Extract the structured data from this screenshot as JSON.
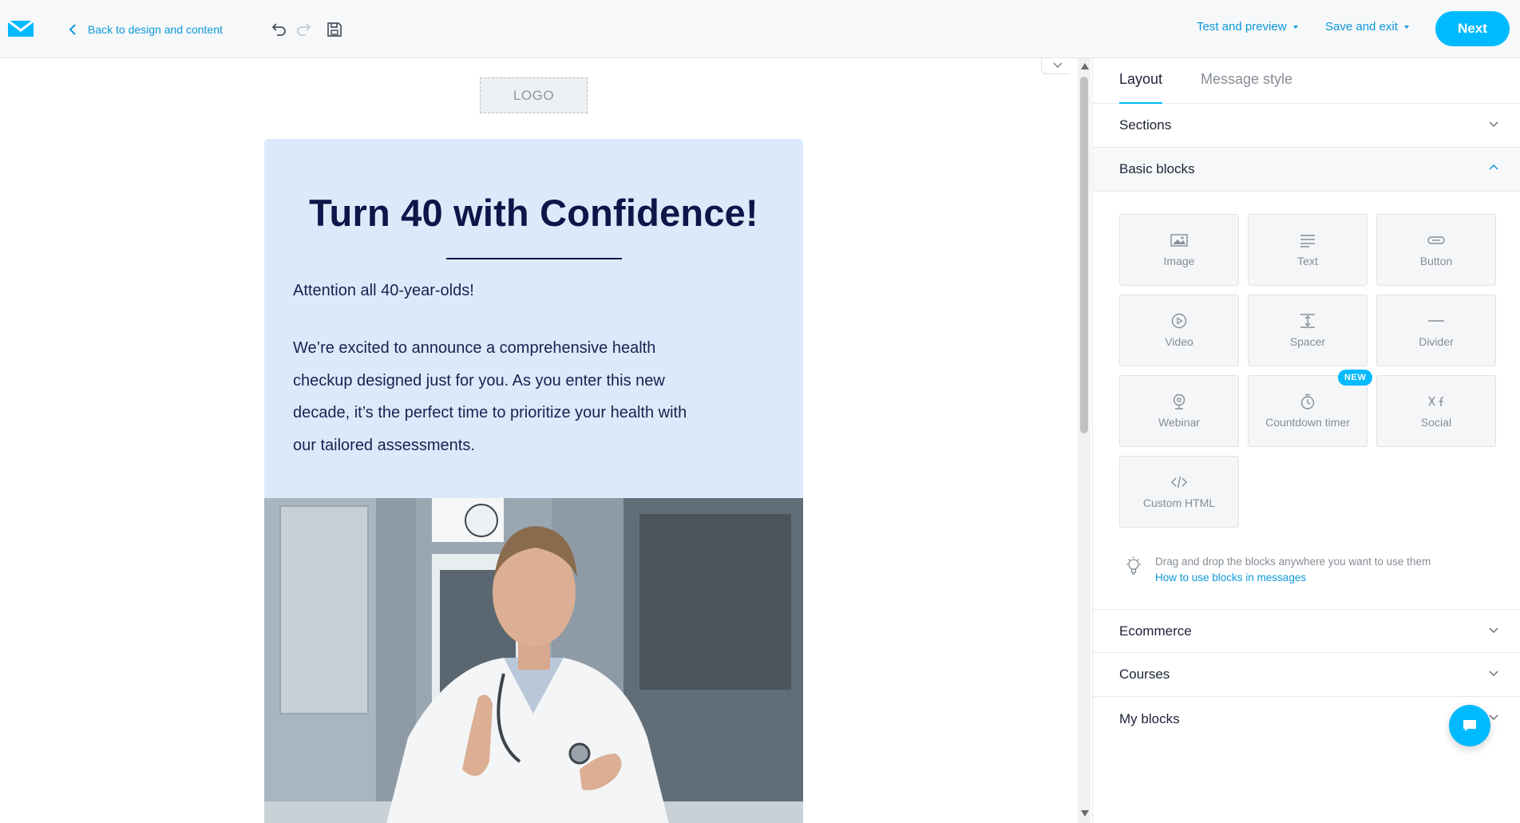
{
  "colors": {
    "accent": "#00baff",
    "link": "#0d99d9",
    "hero_background": "#dbeafa",
    "title_navy": "#0f1449"
  },
  "header": {
    "back_label": "Back to design and content",
    "test_preview_label": "Test and preview",
    "save_exit_label": "Save and exit",
    "next_label": "Next",
    "icons": [
      "brand-mail-logo",
      "back-chevron-icon",
      "undo-icon",
      "redo-icon",
      "save-icon"
    ]
  },
  "canvas": {
    "logo_placeholder": "LOGO",
    "email": {
      "title": "Turn 40 with Confidence!",
      "paragraph1": "Attention all 40-year-olds!",
      "paragraph2_lines": [
        "We’re excited to announce a comprehensive health",
        "checkup designed just for you. As you enter this new",
        "decade, it’s the perfect time to prioritize your health with",
        "our tailored assessments."
      ]
    }
  },
  "panel": {
    "tabs": [
      {
        "label": "Layout",
        "active": true
      },
      {
        "label": "Message style",
        "active": false
      }
    ],
    "sections_label": "Sections",
    "basic_blocks_label": "Basic blocks",
    "blocks": [
      {
        "label": "Image",
        "icon": "image-icon"
      },
      {
        "label": "Text",
        "icon": "text-icon"
      },
      {
        "label": "Button",
        "icon": "button-icon"
      },
      {
        "label": "Video",
        "icon": "video-icon"
      },
      {
        "label": "Spacer",
        "icon": "spacer-icon"
      },
      {
        "label": "Divider",
        "icon": "divider-icon"
      },
      {
        "label": "Webinar",
        "icon": "webinar-icon"
      },
      {
        "label": "Countdown timer",
        "icon": "timer-icon",
        "badge": "NEW"
      },
      {
        "label": "Social",
        "icon": "social-icon"
      },
      {
        "label": "Custom HTML",
        "icon": "code-icon"
      }
    ],
    "hint_text": "Drag and drop the blocks anywhere you want to use them",
    "hint_link": "How to use blocks in messages",
    "ecommerce_label": "Ecommerce",
    "courses_label": "Courses",
    "my_blocks_label": "My blocks"
  }
}
